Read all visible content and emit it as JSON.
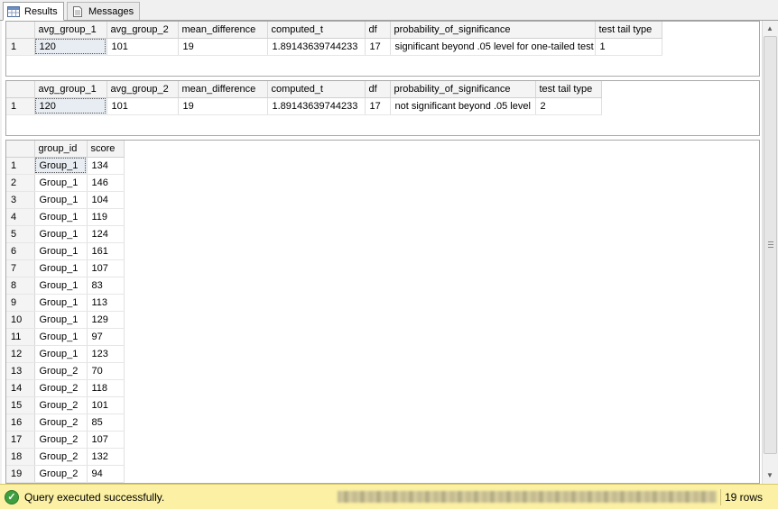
{
  "tabs": [
    {
      "label": "Results",
      "icon": "grid-icon",
      "active": true
    },
    {
      "label": "Messages",
      "icon": "document-icon",
      "active": false
    }
  ],
  "grid1": {
    "columns": [
      "avg_group_1",
      "avg_group_2",
      "mean_difference",
      "computed_t",
      "df",
      "probability_of_significance",
      "test tail type"
    ],
    "rows": [
      [
        "1",
        "120",
        "101",
        "19",
        "1.89143639744233",
        "17",
        "significant beyond .05 level for one-tailed test",
        "1"
      ]
    ]
  },
  "grid2": {
    "columns": [
      "avg_group_1",
      "avg_group_2",
      "mean_difference",
      "computed_t",
      "df",
      "probability_of_significance",
      "test tail type"
    ],
    "rows": [
      [
        "1",
        "120",
        "101",
        "19",
        "1.89143639744233",
        "17",
        "not significant beyond .05 level",
        "2"
      ]
    ]
  },
  "grid3": {
    "columns": [
      "group_id",
      "score"
    ],
    "rows": [
      [
        "1",
        "Group_1",
        "134"
      ],
      [
        "2",
        "Group_1",
        "146"
      ],
      [
        "3",
        "Group_1",
        "104"
      ],
      [
        "4",
        "Group_1",
        "119"
      ],
      [
        "5",
        "Group_1",
        "124"
      ],
      [
        "6",
        "Group_1",
        "161"
      ],
      [
        "7",
        "Group_1",
        "107"
      ],
      [
        "8",
        "Group_1",
        "83"
      ],
      [
        "9",
        "Group_1",
        "113"
      ],
      [
        "10",
        "Group_1",
        "129"
      ],
      [
        "11",
        "Group_1",
        "97"
      ],
      [
        "12",
        "Group_1",
        "123"
      ],
      [
        "13",
        "Group_2",
        "70"
      ],
      [
        "14",
        "Group_2",
        "118"
      ],
      [
        "15",
        "Group_2",
        "101"
      ],
      [
        "16",
        "Group_2",
        "85"
      ],
      [
        "17",
        "Group_2",
        "107"
      ],
      [
        "18",
        "Group_2",
        "132"
      ],
      [
        "19",
        "Group_2",
        "94"
      ]
    ]
  },
  "status": {
    "message": "Query executed successfully.",
    "row_count": "19 rows",
    "icon": "check-circle-icon",
    "background_color": "#fbf0a3"
  }
}
